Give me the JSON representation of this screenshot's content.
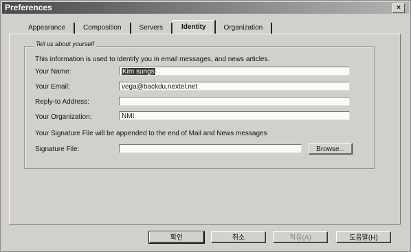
{
  "window": {
    "title": "Preferences",
    "close_glyph": "×"
  },
  "tabs": [
    {
      "label": "Appearance"
    },
    {
      "label": "Composition"
    },
    {
      "label": "Servers"
    },
    {
      "label": "Identity",
      "active": true
    },
    {
      "label": "Organization"
    }
  ],
  "identity": {
    "legend": "Tell us about yourself",
    "description": "This information is used to identify you in email messages, and news articles.",
    "fields": {
      "name": {
        "label": "Your Name:",
        "value": "Kim sungs"
      },
      "email": {
        "label": "Your Email:",
        "value": "vega@backdu.nextel.net"
      },
      "reply_to": {
        "label": "Reply-to Address:",
        "value": ""
      },
      "organization": {
        "label": "Your Organization:",
        "value": "NMI"
      }
    },
    "signature_note": "Your Signature File will be appended to the end of Mail and News messages",
    "signature": {
      "label": "Signature File:",
      "value": "",
      "browse_label": "Browse..."
    }
  },
  "buttons": {
    "ok": "확인",
    "cancel": "취소",
    "apply": "적용(A)",
    "help": "도움말(H)"
  }
}
